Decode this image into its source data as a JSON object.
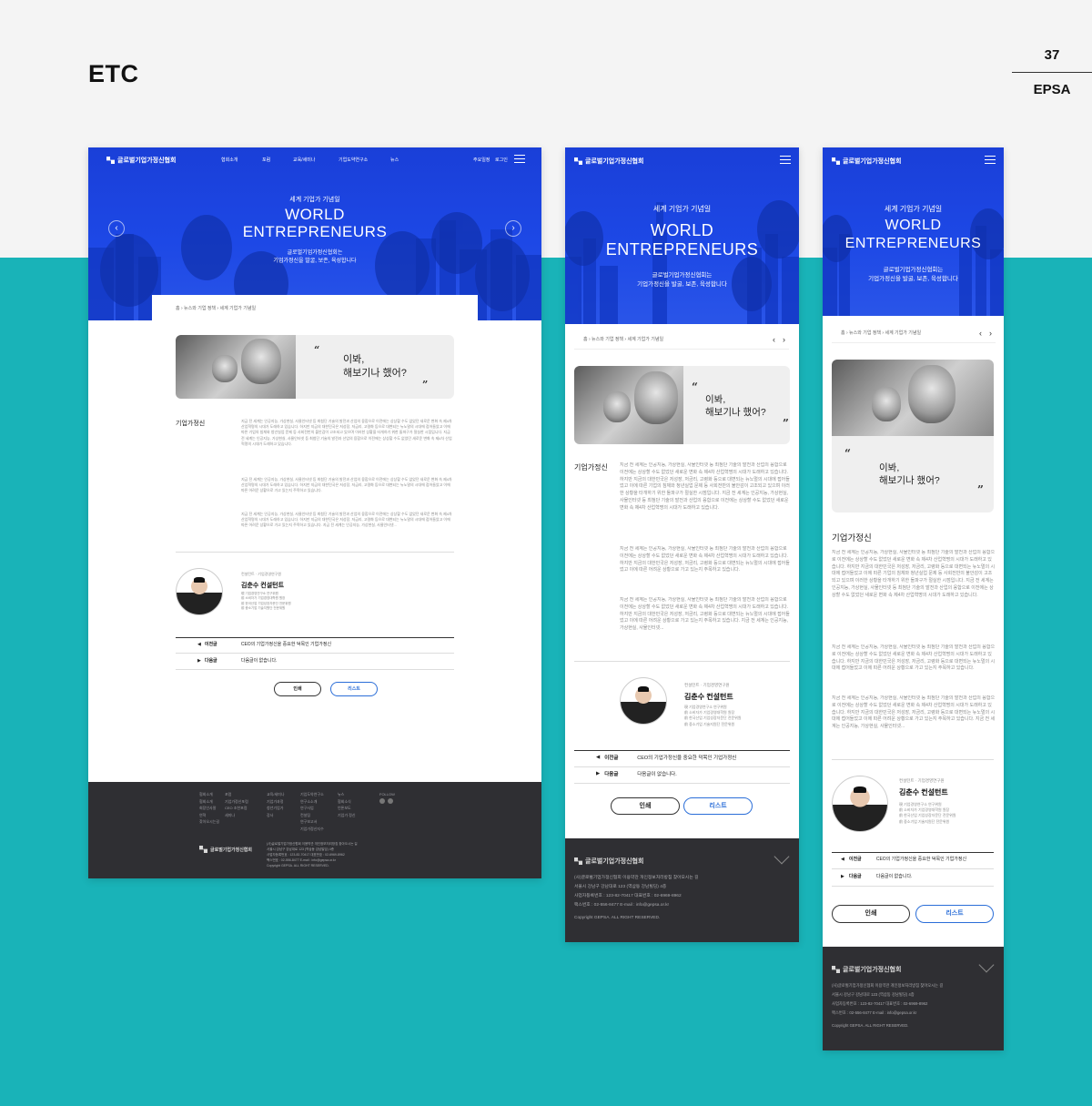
{
  "page": {
    "section": "ETC",
    "number": "37",
    "brand": "EPSA"
  },
  "site": {
    "logo": "글로벌기업가정신협회",
    "nav": [
      "협회소개",
      "포럼",
      "교육/세미나",
      "기업도약연구소",
      "뉴스"
    ],
    "util": [
      "주요일정",
      "로그인"
    ],
    "hero_sub": "세계 기업가 기념일",
    "hero_title_1": "WORLD",
    "hero_title_2": "ENTREPRENEURS",
    "hero_desc_1": "글로벌기업가정신협회는",
    "hero_desc_2": "기업가정신을 발굴, 보존, 육성합니다",
    "breadcrumb": "홈 › 뉴스와 기업 정책 › 세계 기업가 기념일",
    "quote_1": "이봐,",
    "quote_2": "해보기나 했어?",
    "section_title": "기업가정신",
    "para1": "지금 전 세계는 인공지능, 가상현실, 사물인터넷 등 최첨단 기술의 발전과 산업의 융합으로 이전에는 상상할 수도 없었던 새로운 변화 속 제4차 산업혁명의 시대가 도래하고 있습니다. 하지만 지금의 대한민국은 저성장, 저금리, 고령화 등으로 대변되는 뉴노멀의 시대에 접어들었고 이에 따른 기업의 침체와 청년실업 문제 등 사회전반의 불안감이 고조되고 있으며 이러한 상황을 타개하기 위한 돌파구가 절실한 시점입니다. 지금 전 세계는 인공지능, 가상현실, 사물인터넷 등 최첨단 기술의 발전과 산업의 융합으로 이전에는 상상할 수도 없었던 새로운 변화 속 제4차 산업혁명의 시대가 도래하고 있습니다.",
    "para2": "지금 전 세계는 인공지능, 가상현실, 사물인터넷 등 최첨단 기술의 발전과 산업의 융합으로 이전에는 상상할 수도 없었던 새로운 변화 속 제4차 산업혁명의 시대가 도래하고 있습니다. 하지만 지금의 대한민국은 저성장, 저금리, 고령화 등으로 대변되는 뉴노멀의 시대에 접어들었고 이에 따른 어려운 상황으로 가고 있는지 주목하고 있습니다.",
    "para3": "지금 전 세계는 인공지능, 가상현실, 사물인터넷 등 최첨단 기술의 발전과 산업의 융합으로 이전에는 상상할 수도 없었던 새로운 변화 속 제4차 산업혁명의 시대가 도래하고 있습니다. 하지만 지금의 대한민국은 저성장, 저금리, 고령화 등으로 대변되는 뉴노멀의 시대에 접어들었고 이에 따른 어려운 상황으로 가고 있는지 주목하고 있습니다. 지금 전 세계는 인공지능, 가상현실, 사물인터넷...",
    "consultant_role": "컨설턴트 · 기업경영연구원",
    "consultant_name": "김춘수 컨설턴트",
    "consultant_items": [
      "現 기업경영연구소 연구위원",
      "前 소비자가 기업경영대학원 원장",
      "前 한국산업 기업성장자문단 전문위원",
      "前 중소기업 기술지원단 전문위원"
    ],
    "prev_label": "이전글",
    "prev_text": "CEO의 기업가정신을 중요한 덕목인 기업가정신",
    "next_label": "다음글",
    "next_text": "다음글이 없습니다.",
    "print_btn": "인쇄",
    "list_btn": "리스트",
    "footer_links": "(사)글로벌기업가정신협회   이용약관   개인정보처리방침   찾아오시는 길",
    "footer_addr": "서울시 강남구 강남대로 123 (역삼동 강남빌딩) 4층",
    "footer_biz": "사업자등록번호 : 123-82-70417    대표번호 : 02-6969-8962",
    "footer_fax": "팩스번호 : 02-556-8477    E-mail : info@gepsa.or.kr",
    "footer_copy": "Copyright GEPSA. ALL RIGHT RESERVED.",
    "footer_cols": [
      [
        "협회소개",
        "협회소개",
        "회장인사말",
        "연혁",
        "찾아오시는길"
      ],
      [
        "포럼",
        "기업가정신포럼",
        "CEO 조찬포럼",
        "세미나"
      ],
      [
        "교육/세미나",
        "기업가과정",
        "청년기업가",
        "강사"
      ],
      [
        "기업도약연구소",
        "연구소소개",
        "연구사업",
        "컨설팅",
        "연구보고서",
        "기업가정신지수"
      ],
      [
        "뉴스",
        "협회소식",
        "언론보도",
        "기업가 정신"
      ],
      [
        "FOLLOW"
      ]
    ]
  },
  "colors": {
    "hero_blue": "#1d48e6",
    "teal": "#19b3b8",
    "footer": "#2f2f33",
    "list_blue": "#2b6ed8"
  }
}
